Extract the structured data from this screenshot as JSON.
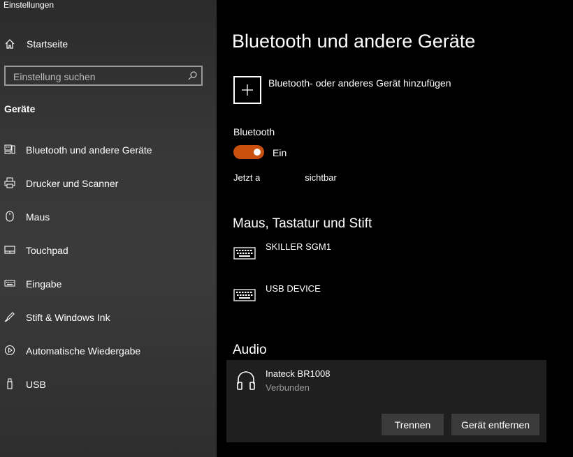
{
  "window": {
    "title": "Einstellungen"
  },
  "sidebar": {
    "home_label": "Startseite",
    "search_placeholder": "Einstellung suchen",
    "section_label": "Geräte",
    "items": [
      {
        "label": "Bluetooth und andere Geräte",
        "icon": "bluetooth-devices-icon"
      },
      {
        "label": "Drucker und Scanner",
        "icon": "printer-icon"
      },
      {
        "label": "Maus",
        "icon": "mouse-icon"
      },
      {
        "label": "Touchpad",
        "icon": "touchpad-icon"
      },
      {
        "label": "Eingabe",
        "icon": "keyboard-icon"
      },
      {
        "label": "Stift & Windows Ink",
        "icon": "pen-icon"
      },
      {
        "label": "Automatische Wiedergabe",
        "icon": "autoplay-icon"
      },
      {
        "label": "USB",
        "icon": "usb-icon"
      }
    ]
  },
  "main": {
    "title": "Bluetooth und andere Geräte",
    "add_device_label": "Bluetooth- oder anderes Gerät hinzufügen",
    "bluetooth_label": "Bluetooth",
    "bluetooth_state": "Ein",
    "bluetooth_on": true,
    "visible_prefix": "Jetzt a",
    "visible_suffix": "sichtbar",
    "input_section_title": "Maus, Tastatur und Stift",
    "input_devices": [
      {
        "name": "SKILLER SGM1",
        "icon": "keyboard-icon"
      },
      {
        "name": "USB DEVICE",
        "icon": "keyboard-icon"
      }
    ],
    "audio_section_title": "Audio",
    "audio_device": {
      "name": "Inateck BR1008",
      "status": "Verbunden",
      "icon": "headphones-icon",
      "disconnect_label": "Trennen",
      "remove_label": "Gerät entfernen"
    }
  },
  "colors": {
    "accent": "#ca5010",
    "sidebar_bg": "#333333",
    "main_bg": "#000000",
    "card_bg": "#1f1f1f"
  }
}
